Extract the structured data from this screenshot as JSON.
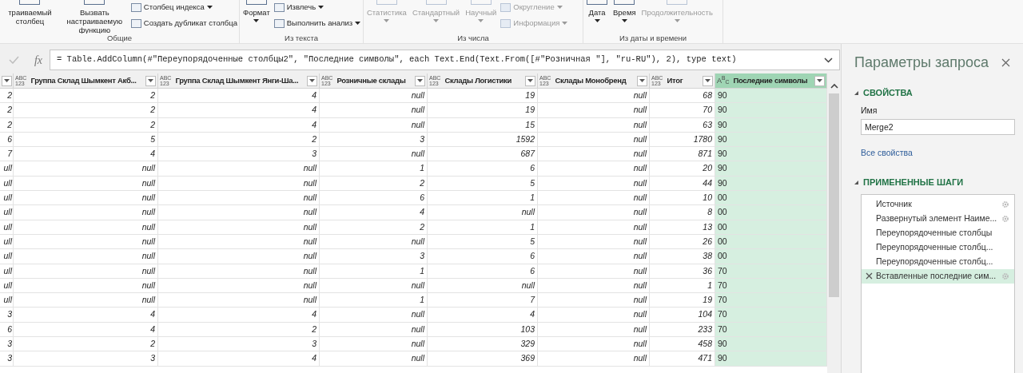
{
  "ribbon": {
    "groups": [
      {
        "label": "Общие",
        "big_buttons": [
          {
            "label": "траиваемый столбец",
            "disabled": false,
            "dropdown": false
          },
          {
            "label": "Вызвать настраиваемую функцию",
            "disabled": false,
            "dropdown": false
          }
        ],
        "small_buttons": [
          {
            "label": "Столбец индекса",
            "disabled": false,
            "dropdown": true
          },
          {
            "label": "Создать дубликат столбца",
            "disabled": false,
            "dropdown": false
          }
        ]
      },
      {
        "label": "Из текста",
        "big_buttons": [
          {
            "label": "Формат",
            "disabled": false,
            "dropdown": true
          }
        ],
        "small_buttons": [
          {
            "label": "Извлечь",
            "disabled": false,
            "dropdown": true
          },
          {
            "label": "Выполнить анализ",
            "disabled": false,
            "dropdown": true
          }
        ]
      },
      {
        "label": "Из числа",
        "big_buttons": [
          {
            "label": "Статистика",
            "disabled": true,
            "dropdown": true
          },
          {
            "label": "Стандартный",
            "disabled": true,
            "dropdown": true
          },
          {
            "label": "Научный",
            "disabled": true,
            "dropdown": true
          }
        ],
        "small_buttons": [
          {
            "label": "Округление",
            "disabled": true,
            "dropdown": true
          },
          {
            "label": "Информация",
            "disabled": true,
            "dropdown": true
          }
        ]
      },
      {
        "label": "Из даты и времени",
        "big_buttons": [
          {
            "label": "Дата",
            "disabled": false,
            "dropdown": true
          },
          {
            "label": "Время",
            "disabled": false,
            "dropdown": true
          },
          {
            "label": "Продолжительность",
            "disabled": true,
            "dropdown": true
          }
        ]
      }
    ]
  },
  "formula_bar": {
    "fx_label": "fx",
    "formula": "= Table.AddColumn(#\"Переупорядоченные столбцы2\", \"Последние символы\", each Text.End(Text.From([#\"Розничная \"], \"ru-RU\"), 2), type text)"
  },
  "table": {
    "columns": [
      {
        "selected": false
      },
      {
        "name": "Группа Склад Шымкент Акб...",
        "type": {
          "kind": "any",
          "lines": [
            "ABC",
            "123"
          ]
        },
        "selected": false
      },
      {
        "name": "Группа Склад Шымкент Янги-Ша...",
        "type": {
          "kind": "any",
          "lines": [
            "ABC",
            "123"
          ]
        },
        "selected": false
      },
      {
        "name": "Розничные склады",
        "type": {
          "kind": "any",
          "lines": [
            "ABC",
            "123"
          ]
        },
        "selected": false
      },
      {
        "name": "Склады Логистики",
        "type": {
          "kind": "any",
          "lines": [
            "ABC",
            "123"
          ]
        },
        "selected": false
      },
      {
        "name": "Склады Монобренд",
        "type": {
          "kind": "any",
          "lines": [
            "ABC",
            "123"
          ]
        },
        "selected": false
      },
      {
        "name": "Итог",
        "type": {
          "kind": "any",
          "lines": [
            "ABC",
            "123"
          ]
        },
        "selected": false
      },
      {
        "name": "Последние символы",
        "type": {
          "kind": "text",
          "label": "A$^{B}$$_{C}$"
        },
        "selected": true
      }
    ],
    "rows": [
      [
        "2",
        "2",
        "4",
        "null",
        "19",
        "null",
        "68",
        "90"
      ],
      [
        "2",
        "2",
        "4",
        "null",
        "19",
        "null",
        "70",
        "90"
      ],
      [
        "2",
        "2",
        "4",
        "null",
        "15",
        "null",
        "63",
        "90"
      ],
      [
        "6",
        "5",
        "2",
        "3",
        "1592",
        "null",
        "1780",
        "90"
      ],
      [
        "7",
        "4",
        "3",
        "null",
        "687",
        "null",
        "871",
        "90"
      ],
      [
        "ull",
        "null",
        "null",
        "1",
        "6",
        "null",
        "20",
        "90"
      ],
      [
        "ull",
        "null",
        "null",
        "2",
        "5",
        "null",
        "44",
        "90"
      ],
      [
        "ull",
        "null",
        "null",
        "6",
        "1",
        "null",
        "10",
        "00"
      ],
      [
        "ull",
        "null",
        "null",
        "4",
        "null",
        "null",
        "8",
        "00"
      ],
      [
        "ull",
        "null",
        "null",
        "2",
        "1",
        "null",
        "13",
        "00"
      ],
      [
        "ull",
        "null",
        "null",
        "null",
        "5",
        "null",
        "26",
        "00"
      ],
      [
        "ull",
        "null",
        "null",
        "3",
        "6",
        "null",
        "38",
        "00"
      ],
      [
        "ull",
        "null",
        "null",
        "1",
        "6",
        "null",
        "36",
        "70"
      ],
      [
        "ull",
        "null",
        "null",
        "null",
        "null",
        "null",
        "1",
        "70"
      ],
      [
        "ull",
        "null",
        "null",
        "1",
        "7",
        "null",
        "19",
        "70"
      ],
      [
        "3",
        "4",
        "4",
        "null",
        "4",
        "null",
        "104",
        "70"
      ],
      [
        "6",
        "4",
        "2",
        "null",
        "103",
        "null",
        "233",
        "70"
      ],
      [
        "3",
        "2",
        "3",
        "null",
        "329",
        "null",
        "458",
        "90"
      ],
      [
        "3",
        "3",
        "4",
        "null",
        "369",
        "null",
        "471",
        "90"
      ]
    ]
  },
  "query_settings": {
    "title": "Параметры запроса",
    "properties": {
      "heading": "СВОЙСТВА",
      "expanded": true,
      "name_label": "Имя",
      "name_value": "Merge2",
      "all_properties_link": "Все свойства"
    },
    "steps": {
      "heading": "ПРИМЕНЕННЫЕ ШАГИ",
      "expanded": true,
      "items": [
        {
          "label": "Источник",
          "has_settings": true,
          "selected": false
        },
        {
          "label": "Развернутый элемент Наиме...",
          "has_settings": true,
          "selected": false
        },
        {
          "label": "Переупорядоченные столбцы",
          "has_settings": false,
          "selected": false
        },
        {
          "label": "Переупорядоченные столбц...",
          "has_settings": false,
          "selected": false
        },
        {
          "label": "Переупорядоченные столбц...",
          "has_settings": false,
          "selected": false
        },
        {
          "label": "Вставленные последние сим...",
          "has_settings": true,
          "selected": true
        }
      ]
    }
  }
}
